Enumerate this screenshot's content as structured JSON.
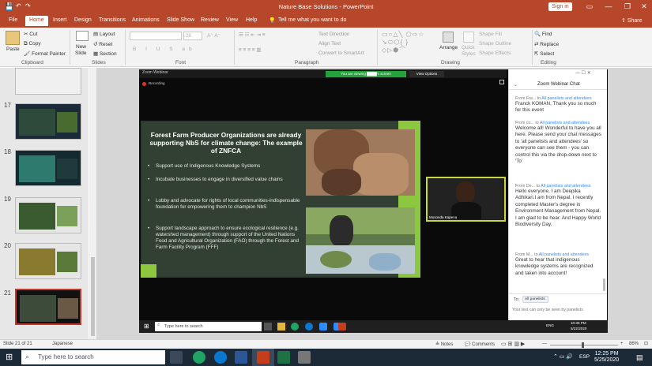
{
  "title_bar": {
    "title": "Nature Base Solutions  -  PowerPoint",
    "signin": "Sign in"
  },
  "ribbon_tabs": [
    "File",
    "Home",
    "Insert",
    "Design",
    "Transitions",
    "Animations",
    "Slide Show",
    "Review",
    "View",
    "Help"
  ],
  "tell_me": "Tell me what you want to do",
  "share_label": "Share",
  "clipboard": {
    "paste": "Paste",
    "cut": "Cut",
    "copy": "Copy",
    "format_painter": "Format Painter",
    "group": "Clipboard"
  },
  "slides_group": {
    "new_slide": "New",
    "new_slide2": "Slide",
    "layout": "Layout",
    "reset": "Reset",
    "section": "Section",
    "group": "Slides"
  },
  "font_group": {
    "size": "28",
    "group": "Font"
  },
  "paragraph_group": {
    "text_direction": "Text Direction",
    "align_text": "Align Text",
    "smartart": "Convert to SmartArt",
    "group": "Paragraph"
  },
  "drawing_group": {
    "arrange": "Arrange",
    "quick": "Quick",
    "styles": "Styles",
    "fill": "Shape Fill",
    "outline": "Shape Outline",
    "effects": "Shape Effects",
    "group": "Drawing"
  },
  "editing_group": {
    "find": "Find",
    "replace": "Replace",
    "select": "Select",
    "group": "Editing"
  },
  "thumbnails": [
    {
      "num": "17"
    },
    {
      "num": "18"
    },
    {
      "num": "19"
    },
    {
      "num": "20"
    },
    {
      "num": "21"
    }
  ],
  "zoom": {
    "window_title": "Zoom Webinar",
    "recording": "Recording",
    "viewing_banner": "You are viewing ████'s screen",
    "view_options": "View Options",
    "participant_name": "Musonda Kapena"
  },
  "slide": {
    "title": "Forest Farm Producer Organizations are already supporting NbS for climate change: The example of ZNFCA",
    "bullets": [
      "Support use of Indigenous Knowledge Systems",
      "Incubate businesses to engage in diversified value chains",
      "Lobby and advocate for rights of local communities-indispensable foundation for empowering them to champion NbS",
      "Support landscape approach to ensure ecological resilience (e.g. watershed management) through support of the United Nations Food and Agricultural Organization (FAO) through the Forest and Farm Facility Program (FFF)"
    ]
  },
  "chat": {
    "header": "Zoom Webinar Chat",
    "to_label": "to",
    "audience": "All panelists and attendees",
    "messages": [
      {
        "from": "From Fra...",
        "text": "Franck KOMAN, Thank you so much for this event"
      },
      {
        "from": "From co...",
        "text": "Welcome all! Wonderful to have you all here. Please send your chat messages to 'all panelists and attendees' so everyone can see them - you can control this via the drop-down next to 'To'"
      },
      {
        "from": "From De...",
        "text": "Hello everyone, I am Deepika Adhikari.I am from Nepal. I recently completed Master's degree in Environment Management from Nepal. I am glad to be hear. And Happy World Biodiversity Day."
      },
      {
        "from": "From M...",
        "text": "Great to hear that indigenous knowledge systems are recognized and taken into account!"
      }
    ],
    "to_prefix": "To:",
    "to_select": "All panelists",
    "input_placeholder": "Your text can only be seen by panelists"
  },
  "inner_taskbar": {
    "search": "Type here to search",
    "time": "10:36 PM",
    "date": "5/22/2020",
    "lang": "ENG"
  },
  "statusbar": {
    "slide_info": "Slide 21 of 21",
    "language": "Japanese",
    "notes": "Notes",
    "comments": "Comments",
    "zoom": "86%"
  },
  "taskbar": {
    "search": "Type here to search",
    "time": "12:25 PM",
    "date": "5/25/2020",
    "lang": "ESP"
  }
}
